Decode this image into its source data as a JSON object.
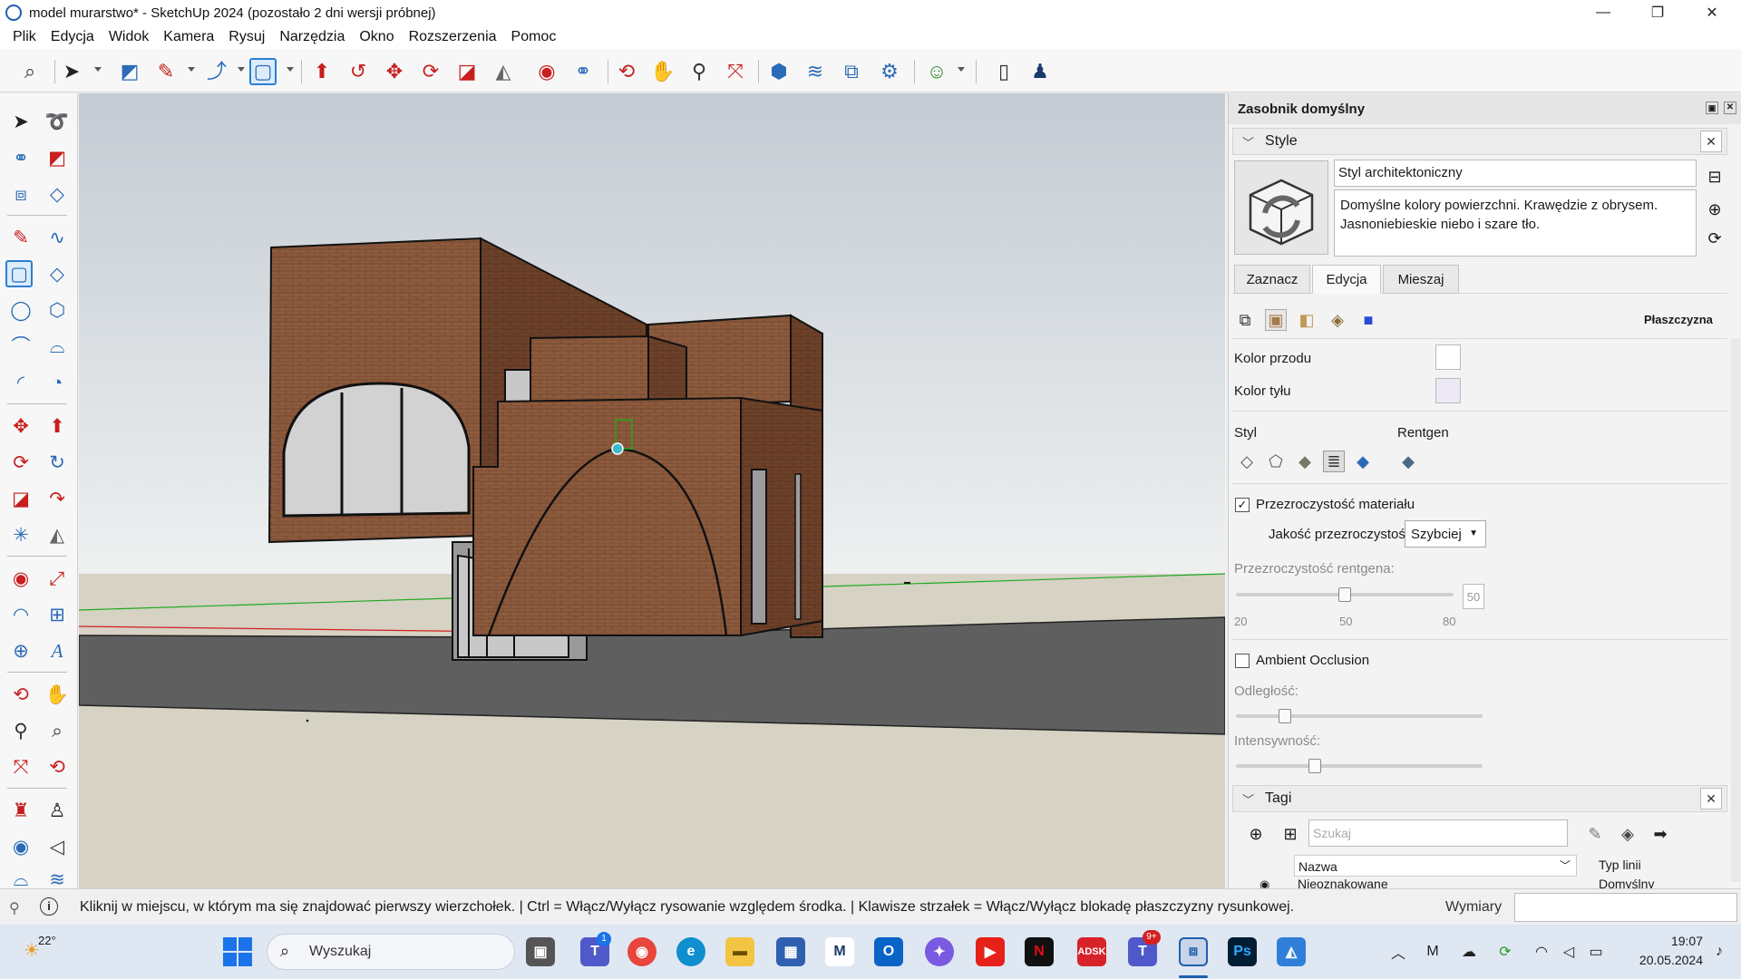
{
  "window": {
    "title": "model murarstwo* - SketchUp 2024 (pozostało 2 dni wersji próbnej)",
    "controls": [
      "—",
      "❐",
      "✕"
    ]
  },
  "menu": [
    "Plik",
    "Edycja",
    "Widok",
    "Kamera",
    "Rysuj",
    "Narzędzia",
    "Okno",
    "Rozszerzenia",
    "Pomoc"
  ],
  "tray": {
    "title": "Zasobnik domyślny",
    "styles": {
      "header": "Style",
      "style_name": "Styl architektoniczny",
      "description": "Domyślne kolory powierzchni. Krawędzie z obrysem. Jasnoniebieskie niebo i szare tło.",
      "tabs": [
        "Zaznacz",
        "Edycja",
        "Mieszaj"
      ],
      "active_tab": "Edycja",
      "plane_label": "Płaszczyzna",
      "front_color_label": "Kolor przodu",
      "back_color_label": "Kolor tyłu",
      "style_label": "Styl",
      "xray_label": "Rentgen",
      "transparency_label": "Przezroczystość materiału",
      "transparency_checked": true,
      "quality_label": "Jakość przezroczystości:",
      "quality_value": "Szybciej",
      "xray_opacity_label": "Przezroczystość rentgena:",
      "xray_value": "50",
      "xray_value_fraction": 0.5,
      "xray_ticks": [
        "20",
        "50",
        "80"
      ],
      "ao_label": "Ambient Occlusion",
      "ao_checked": false,
      "distance_label": "Odległość:",
      "distance_fraction": 0.2,
      "intensity_label": "Intensywność:",
      "intensity_fraction": 0.32
    },
    "tags": {
      "header": "Tagi",
      "search_placeholder": "Szukaj",
      "col_name": "Nazwa",
      "col_linetype": "Typ linii",
      "row_name": "Nieoznakowane",
      "row_linetype": "Domyślny"
    }
  },
  "status": {
    "hint": "Kliknij w miejscu, w którym ma się znajdować pierwszy wierzchołek. | Ctrl = Włącz/Wyłącz rysowanie względem środka. | Klawisze strzałek = Włącz/Wyłącz blokadę płaszczyzny rysunkowej.",
    "measure_label": "Wymiary",
    "measure_value": ""
  },
  "taskbar": {
    "weather": "22°",
    "search_placeholder": "Wyszukaj",
    "time": "19:07",
    "date": "20.05.2024",
    "teams_badge": "1",
    "teams_new_badge": "9+",
    "apps": [
      "ADSK",
      "Ps"
    ]
  },
  "colors": {
    "accent": "#2a7fd4",
    "sky_top": "#c3cbd3",
    "ground": "#d6d2c4",
    "plane": "#5f5f5f",
    "brick": "#8d5a3c"
  }
}
